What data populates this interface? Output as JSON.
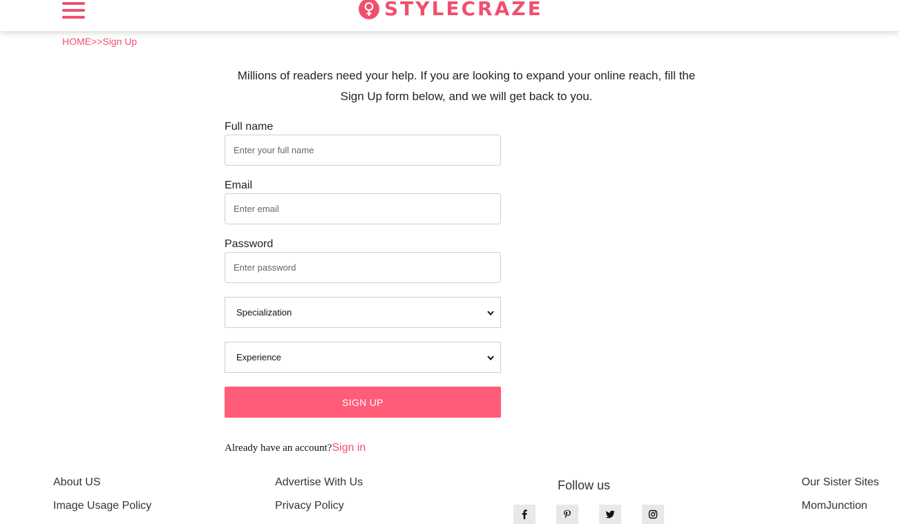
{
  "header": {
    "menu_icon": "hamburger-menu-icon",
    "logo_text": "STYLECRAZE",
    "logo_icon": "female-symbol-icon",
    "brand_color": "#f0506e"
  },
  "breadcrumb": {
    "home": "HOME",
    "separator": ">>",
    "current": "Sign Up"
  },
  "intro_text": "Millions of readers need your help. If you are looking to expand your online reach, fill the Sign Up form below, and we will get back to you.",
  "form": {
    "full_name": {
      "label": "Full name",
      "placeholder": "Enter your full name",
      "value": ""
    },
    "email": {
      "label": "Email",
      "placeholder": "Enter email",
      "value": ""
    },
    "password": {
      "label": "Password",
      "placeholder": "Enter password",
      "value": ""
    },
    "specialization": {
      "selected": "Specialization"
    },
    "experience": {
      "selected": "Experience"
    },
    "submit_label": "SIGN UP",
    "submit_color": "#ff5c7a"
  },
  "signin_prompt": {
    "text": "Already have an account?",
    "link": "Sign in"
  },
  "footer": {
    "about": "About US",
    "image_policy": "Image Usage Policy",
    "advertise": "Advertise With Us",
    "privacy": "Privacy Policy",
    "follow_title": "Follow us",
    "social_icons": [
      "facebook-icon",
      "pinterest-icon",
      "twitter-icon",
      "instagram-icon"
    ],
    "sister_title": "Our Sister Sites",
    "sister_link": "MomJunction"
  }
}
